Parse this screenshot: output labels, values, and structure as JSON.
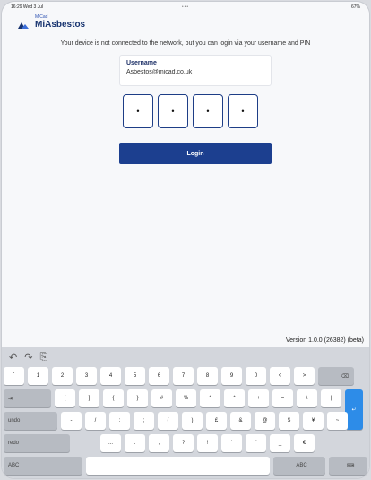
{
  "status_bar": {
    "time": "16:29",
    "date": "Wed 3 Jul",
    "dots": "•••",
    "battery": "67%"
  },
  "logo": {
    "small": "MiCad",
    "main": "MiAsbestos"
  },
  "message": "Your device is not connected to the network, but you can login via your username and PIN",
  "username": {
    "label": "Username",
    "value": "Asbestos@micad.co.uk"
  },
  "pin": {
    "digits": [
      "•",
      "•",
      "•",
      "•"
    ]
  },
  "login_button": "Login",
  "version": "Version 1.0.0 (26382) (beta)",
  "keyboard": {
    "toolbar": [
      "↶",
      "↷",
      "⎘"
    ],
    "row1": [
      "`",
      "1",
      "2",
      "3",
      "4",
      "5",
      "6",
      "7",
      "8",
      "9",
      "0",
      "<",
      ">",
      "⌫"
    ],
    "row2": [
      "⇥",
      "[",
      "]",
      "{",
      "}",
      "#",
      "%",
      "^",
      "*",
      "+",
      "=",
      "\\",
      "|",
      "↵"
    ],
    "row3": [
      "undo",
      "-",
      "/",
      ":",
      ";",
      "(",
      ")",
      "£",
      "&",
      "@",
      "$",
      "¥",
      "~"
    ],
    "row4": [
      "redo",
      "...",
      ".",
      ",",
      "?",
      "!",
      "'",
      "\"",
      "_",
      "€"
    ],
    "row5": [
      "ABC",
      "",
      "ABC",
      "⌨"
    ]
  },
  "colors": {
    "primary": "#1c3f8f",
    "accent": "#2d8ce8",
    "background": "#f7f8fa"
  }
}
